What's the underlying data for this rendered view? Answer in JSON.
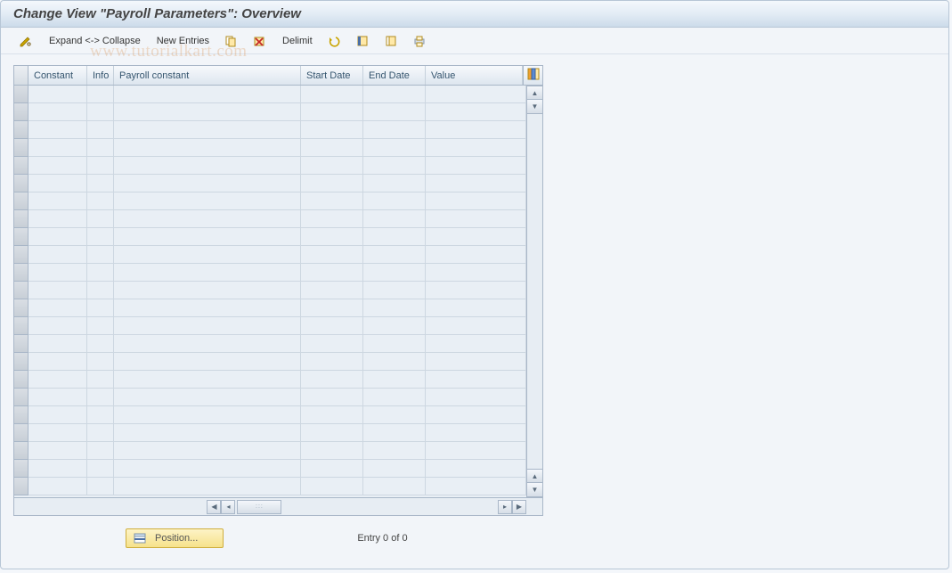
{
  "title": "Change View \"Payroll Parameters\": Overview",
  "toolbar": {
    "expand_collapse": "Expand <-> Collapse",
    "new_entries": "New Entries",
    "delimit": "Delimit"
  },
  "columns": {
    "constant": "Constant",
    "info": "Info",
    "payroll_constant": "Payroll constant",
    "start_date": "Start Date",
    "end_date": "End Date",
    "value": "Value"
  },
  "footer": {
    "position": "Position...",
    "entry": "Entry 0 of 0"
  },
  "watermark": "www.tutorialkart.com"
}
